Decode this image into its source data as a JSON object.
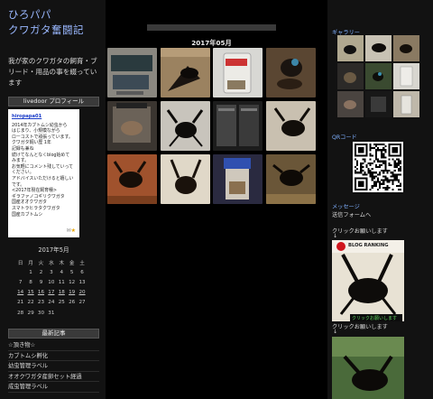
{
  "blog": {
    "title_line1": "ひろパパ",
    "title_line2": "クワガタ奮闘記",
    "description": "我が家のクワガタの飼育・ブリード・用品の事を綴っています"
  },
  "profile": {
    "header": "livedoor プロフィール",
    "name": "hiropapa01",
    "bio_lines": [
      "2014年カブトムシ幼虫から",
      "はじまり、小規模ながら",
      "ローコストで頑張っています。",
      "クワガタ飼い歴 1年",
      "記録も兼ね",
      "続けてなんとなくblog始めて",
      "みます。",
      "お気軽にコメント残していって",
      "ください。",
      "アドバイスいただけると嬉しい",
      "です。",
      "<2017年現在飼育種>",
      "ギラファノコギリクワガタ",
      "国産オオクワガタ",
      "スマトラヒラタクワガタ",
      "国産カブトムシ"
    ]
  },
  "calendar": {
    "title": "2017年5月",
    "weekdays": [
      "日",
      "月",
      "火",
      "水",
      "木",
      "金",
      "土"
    ],
    "weeks": [
      [
        "",
        "1",
        "2",
        "3",
        "4",
        "5",
        "6"
      ],
      [
        "7",
        "8",
        "9",
        "10",
        "11",
        "12",
        "13"
      ],
      [
        "14",
        "15",
        "16",
        "17",
        "18",
        "19",
        "20"
      ],
      [
        "21",
        "22",
        "23",
        "24",
        "25",
        "26",
        "27"
      ],
      [
        "28",
        "29",
        "30",
        "31",
        "",
        "",
        ""
      ]
    ]
  },
  "recent": {
    "header": "最新記事",
    "items": [
      "☆頂き物☆",
      "カブトムシ孵化",
      "幼虫管理ラベル",
      "オオクワガタ産卵セット経過",
      "成虫管理ラベル"
    ]
  },
  "center": {
    "month_title": "2017年05月"
  },
  "sidebar": {
    "gallery_label": "ギャラリー",
    "qr_label": "QRコード",
    "message_label": "メッセージ",
    "message_link": "送信フォームへ",
    "click_label_1": "クリックお願いします",
    "click_label_2": "クリックお願いします",
    "arrow": "↓",
    "rank_banner_text": "BLOG RANKING",
    "rank_banner_caption": "クリックお願いします"
  },
  "colors": {
    "title_blue": "#9ab8ff",
    "sidebar_heading": "#7fb0ff",
    "background": "#000000",
    "panel": "#121212"
  }
}
